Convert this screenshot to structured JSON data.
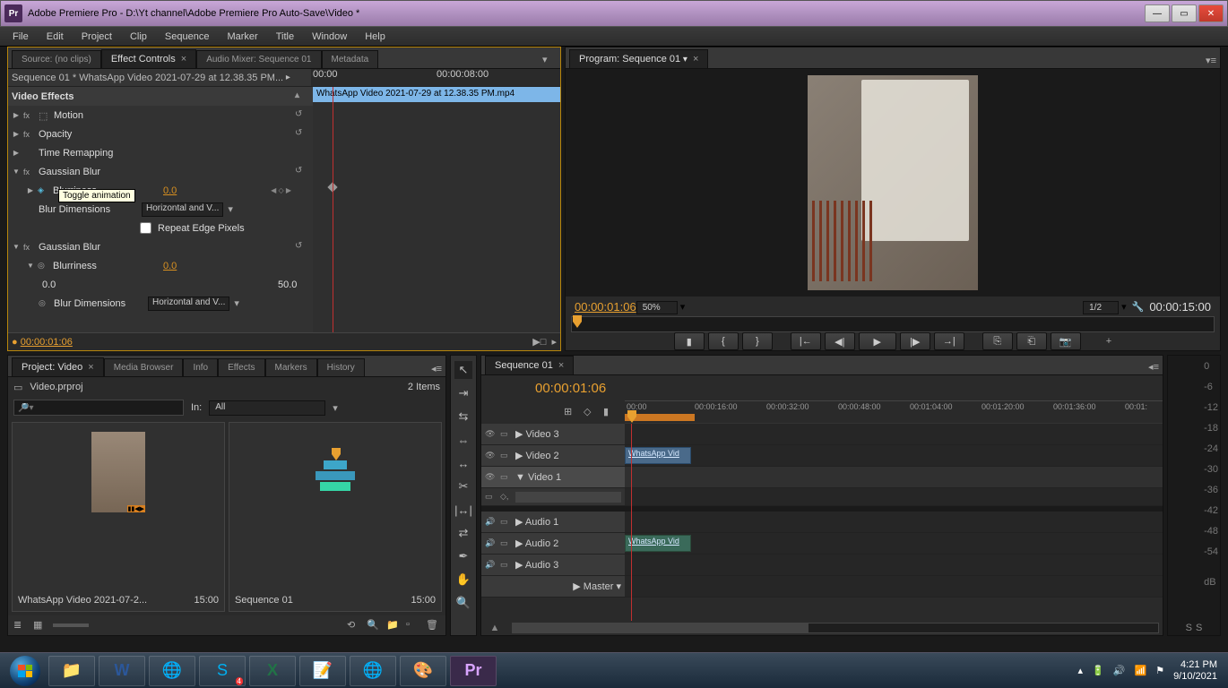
{
  "title": "Adobe Premiere Pro - D:\\Yt channel\\Adobe Premiere Pro Auto-Save\\Video *",
  "menu": [
    "File",
    "Edit",
    "Project",
    "Clip",
    "Sequence",
    "Marker",
    "Title",
    "Window",
    "Help"
  ],
  "source_tabs": [
    {
      "label": "Source: (no clips)",
      "active": false
    },
    {
      "label": "Effect Controls",
      "active": true
    },
    {
      "label": "Audio Mixer: Sequence 01",
      "active": false
    },
    {
      "label": "Metadata",
      "active": false
    }
  ],
  "effect_controls": {
    "header_left": "Sequence 01 * WhatsApp Video 2021-07-29 at 12.38.35 PM...",
    "tc_a": "00:00",
    "tc_b": "00:00:08:00",
    "clip_bar": "WhatsApp Video 2021-07-29 at 12.38.35 PM.mp4",
    "section": "Video Effects",
    "rows": [
      {
        "t": "fx",
        "name": "Motion",
        "reset": true
      },
      {
        "t": "fx",
        "name": "Opacity",
        "reset": true
      },
      {
        "t": "plain",
        "name": "Time Remapping"
      },
      {
        "t": "fx",
        "name": "Gaussian Blur",
        "reset": true,
        "open": true
      },
      {
        "t": "param",
        "name": "Blurriness",
        "val": "0.0",
        "keyed": true,
        "kfnav": true
      },
      {
        "t": "param-dd",
        "name": "Blur Dimensions",
        "dd": "Horizontal and V..."
      },
      {
        "t": "check",
        "name": "Repeat Edge Pixels"
      },
      {
        "t": "fx",
        "name": "Gaussian Blur",
        "reset": true,
        "open": true
      },
      {
        "t": "param",
        "name": "Blurriness",
        "val": "0.0"
      },
      {
        "t": "slider",
        "lo": "0.0",
        "hi": "50.0"
      },
      {
        "t": "param-dd",
        "name": "Blur Dimensions",
        "dd": "Horizontal and V..."
      }
    ],
    "tooltip": "Toggle animation",
    "footer_tc": "00:00:01:06"
  },
  "program": {
    "tab": "Program: Sequence 01",
    "tc_cur": "00:00:01:06",
    "zoom": "50%",
    "res": "1/2",
    "tc_dur": "00:00:15:00",
    "buttons": [
      "marker",
      "in",
      "out",
      "goto-in",
      "step-back",
      "play",
      "step-fwd",
      "goto-out",
      "lift",
      "extract",
      "snapshot"
    ]
  },
  "project": {
    "tabs": [
      "Project: Video",
      "Media Browser",
      "Info",
      "Effects",
      "Markers",
      "History"
    ],
    "file": "Video.prproj",
    "count": "2 Items",
    "filter_label": "In:",
    "filter_val": "All",
    "bins": [
      {
        "name": "WhatsApp Video 2021-07-2...",
        "dur": "15:00",
        "type": "clip"
      },
      {
        "name": "Sequence 01",
        "dur": "15:00",
        "type": "seq"
      }
    ]
  },
  "tools": [
    "selection",
    "track-select",
    "ripple",
    "rolling",
    "rate",
    "razor",
    "slip",
    "slide",
    "pen",
    "hand",
    "zoom"
  ],
  "timeline": {
    "tab": "Sequence 01",
    "tc": "00:00:01:06",
    "ruler": [
      "00:00",
      "00:00:16:00",
      "00:00:32:00",
      "00:00:48:00",
      "00:01:04:00",
      "00:01:20:00",
      "00:01:36:00",
      "00:01:"
    ],
    "tracks_v": [
      "Video 3",
      "Video 2",
      "Video 1"
    ],
    "tracks_a": [
      "Audio 1",
      "Audio 2",
      "Audio 3",
      "Master"
    ],
    "clip_v": "WhatsApp Vid",
    "clip_a": "WhatsApp Vid"
  },
  "meters": [
    "0",
    "-6",
    "-12",
    "-18",
    "-24",
    "-30",
    "-36",
    "-42",
    "-48",
    "-54",
    "",
    "dB"
  ],
  "taskbar": {
    "icons": [
      "explorer",
      "word",
      "chrome",
      "skype",
      "excel",
      "sticky",
      "chrome2",
      "paint",
      "premiere"
    ],
    "time": "4:21 PM",
    "date": "9/10/2021"
  }
}
